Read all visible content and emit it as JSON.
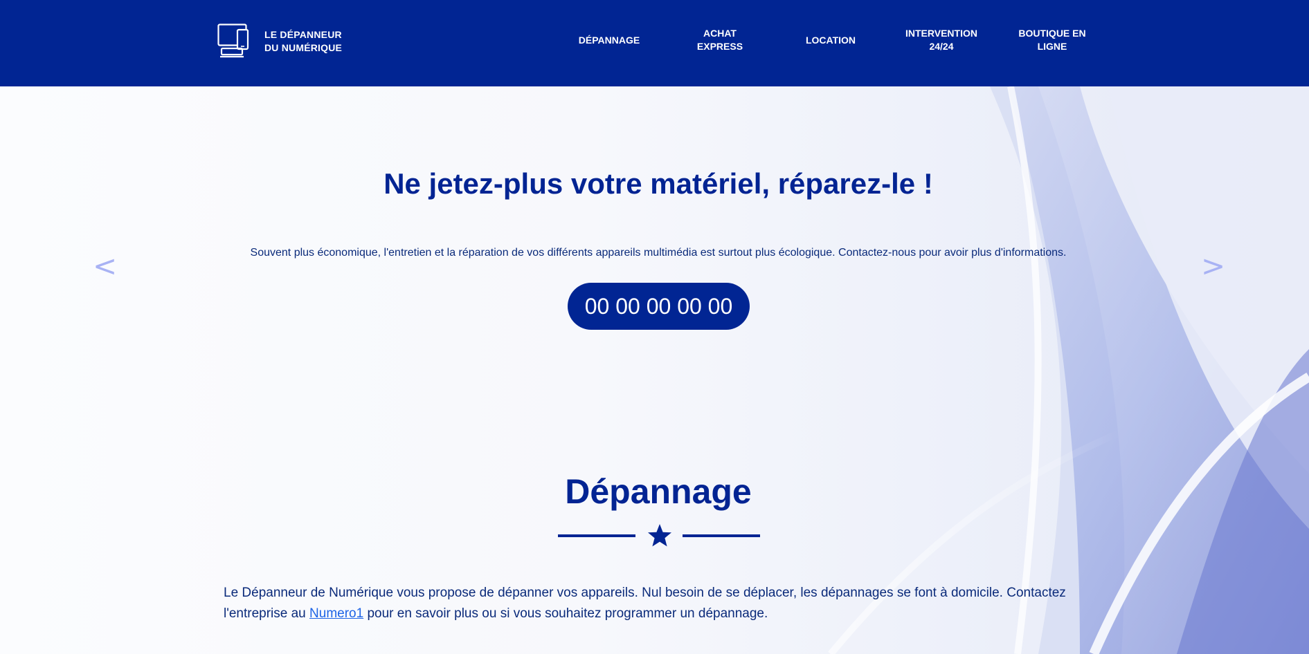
{
  "brand": {
    "line1": "LE DÉPANNEUR",
    "line2": "DU NUMÉRIQUE",
    "logo_icon": "devices-icon"
  },
  "nav": {
    "items": [
      {
        "label": "DÉPANNAGE"
      },
      {
        "label": "ACHAT\nEXPRESS"
      },
      {
        "label": "LOCATION"
      },
      {
        "label": "INTERVENTION\n24/24"
      },
      {
        "label": "BOUTIQUE EN\nLIGNE"
      }
    ]
  },
  "hero": {
    "title": "Ne jetez-plus votre matériel, réparez-le !",
    "subtitle": "Souvent plus économique, l'entretien et la réparation de vos différents appareils multimédia est surtout plus écologique. Contactez-nous pour avoir plus d'informations.",
    "phone": "00 00 00 00 00",
    "prev_arrow": "<",
    "next_arrow": ">"
  },
  "section": {
    "title": "Dépannage",
    "divider_icon": "star-icon",
    "body_before": "Le Dépanneur de Numérique vous propose de dépanner vos appareils. Nul besoin de se déplacer, les dépannages se font à domicile. Contactez l'entreprise au ",
    "body_link": "Numero1",
    "body_after": " pour en savoir plus ou si vous souhaitez programmer un dépannage."
  },
  "colors": {
    "primary": "#012593",
    "text": "#022493",
    "link": "#1e64e6",
    "arrow": "#a8b2f4"
  }
}
